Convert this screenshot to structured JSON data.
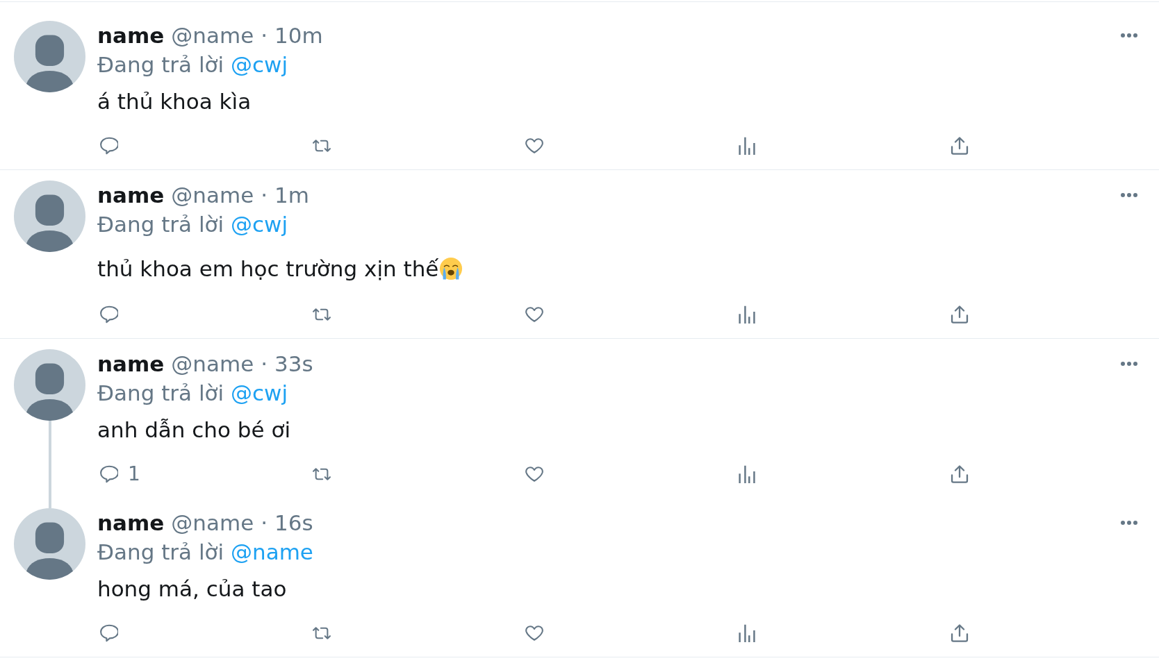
{
  "tweets": [
    {
      "author_name": "name",
      "handle": "@name",
      "dot": "·",
      "time": "10m",
      "reply_prefix": "Đang trả lời",
      "reply_to": "@cwj",
      "text": "á thủ khoa kìa",
      "has_emoji": false,
      "thread_continues": false
    },
    {
      "author_name": "name",
      "handle": "@name",
      "dot": "·",
      "time": "1m",
      "reply_prefix": "Đang trả lời",
      "reply_to": "@cwj",
      "text": "thủ khoa em học trường xịn thế",
      "has_emoji": true,
      "thread_continues": false
    },
    {
      "author_name": "name",
      "handle": "@name",
      "dot": "·",
      "time": "33s",
      "reply_prefix": "Đang trả lời",
      "reply_to": "@cwj",
      "text": "anh dẫn cho bé ơi",
      "has_emoji": false,
      "thread_continues": true,
      "reply_count": "1"
    },
    {
      "author_name": "name",
      "handle": "@name",
      "dot": "·",
      "time": "16s",
      "reply_prefix": "Đang trả lời",
      "reply_to": "@name",
      "text": "hong má, của tao",
      "has_emoji": false,
      "thread_continues": false
    }
  ]
}
